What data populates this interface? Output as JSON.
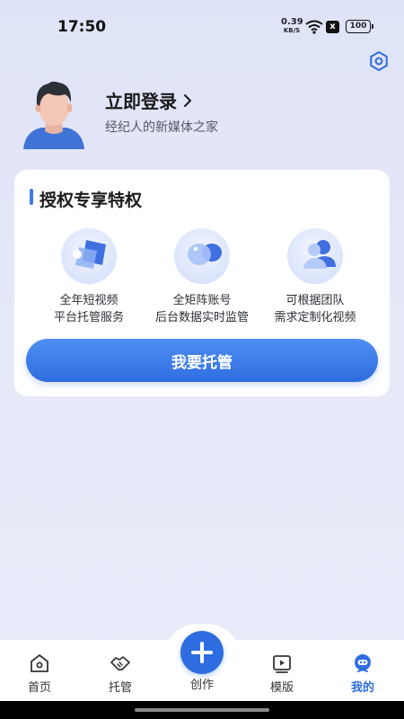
{
  "status_bar": {
    "time": "17:50",
    "net_speed_value": "0.39",
    "net_speed_unit": "KB/S",
    "sim_label": "x",
    "battery": "100"
  },
  "profile": {
    "login_label": "立即登录",
    "subtitle": "经纪人的新媒体之家"
  },
  "privileges": {
    "title": "授权专享特权",
    "items": [
      {
        "line1": "全年短视频",
        "line2": "平台托管服务",
        "icon": "video-folder-icon"
      },
      {
        "line1": "全矩阵账号",
        "line2": "后台数据实时监管",
        "icon": "chat-bubbles-icon"
      },
      {
        "line1": "可根据团队",
        "line2": "需求定制化视频",
        "icon": "user-group-icon"
      }
    ],
    "cta_label": "我要托管"
  },
  "bottom_nav": {
    "items": [
      {
        "label": "首页",
        "icon": "home-icon",
        "active": false
      },
      {
        "label": "托管",
        "icon": "handshake-icon",
        "active": false
      },
      {
        "label": "创作",
        "icon": "plus-icon",
        "active": false
      },
      {
        "label": "模版",
        "icon": "play-template-icon",
        "active": false
      },
      {
        "label": "我的",
        "icon": "robot-face-icon",
        "active": true
      }
    ]
  },
  "colors": {
    "accent": "#2e6de0",
    "background": "#e2e6f8",
    "card": "#ffffff"
  }
}
